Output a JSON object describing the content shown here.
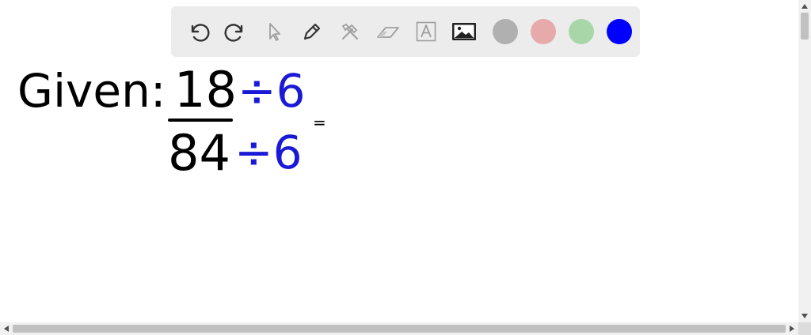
{
  "toolbar": {
    "tools": [
      {
        "name": "undo-icon",
        "color": "#333333"
      },
      {
        "name": "redo-icon",
        "color": "#333333"
      },
      {
        "name": "pointer-icon",
        "color": "#9e9e9e"
      },
      {
        "name": "pen-icon",
        "color": "#333333"
      },
      {
        "name": "tools-icon",
        "color": "#9e9e9e"
      },
      {
        "name": "eraser-icon",
        "color": "#9e9e9e"
      },
      {
        "name": "text-icon",
        "color": "#9e9e9e"
      },
      {
        "name": "image-icon",
        "color": "#333333"
      }
    ],
    "colors": [
      "#b0b0b0",
      "#e6aaaa",
      "#a9d6a9",
      "#0000ff"
    ]
  },
  "whiteboard": {
    "given_label": "Given:",
    "numerator": "18",
    "denominator": "84",
    "divide_numerator": "÷6",
    "divide_denominator": "÷6",
    "equals": "="
  }
}
